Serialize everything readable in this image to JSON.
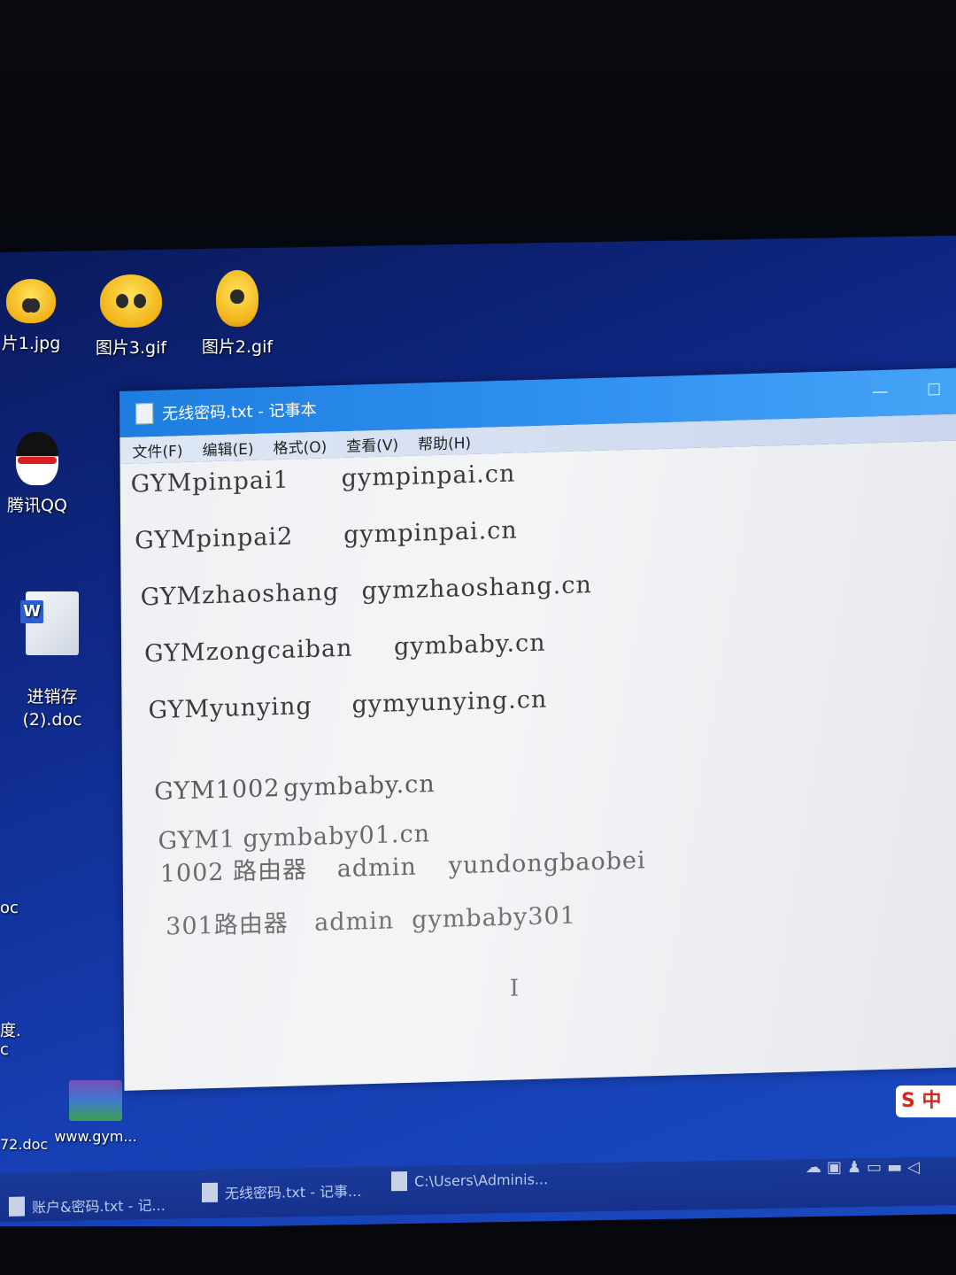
{
  "desktop": {
    "icons": [
      {
        "name": "picture-1",
        "label": "片1.jpg"
      },
      {
        "name": "picture-3",
        "label": "图片3.gif"
      },
      {
        "name": "picture-2",
        "label": "图片2.gif"
      },
      {
        "name": "tencent-qq",
        "label": "腾讯QQ"
      },
      {
        "name": "inventory-doc",
        "label": "进销存\n(2).doc"
      },
      {
        "name": "rar-archive",
        "label": "www.gym..."
      }
    ],
    "partial_labels": {
      "oc": "oc",
      "du": "度.",
      "c": "c",
      "doc2": "72.doc"
    }
  },
  "notepad": {
    "title": "无线密码.txt - 记事本",
    "menu": [
      "文件(F)",
      "编辑(E)",
      "格式(O)",
      "查看(V)",
      "帮助(H)"
    ],
    "lines": [
      {
        "a": "GYMpinpai1",
        "b": "gympinpai.cn"
      },
      {
        "a": "GYMpinpai2",
        "b": "gympinpai.cn"
      },
      {
        "a": "GYMzhaoshang",
        "b": "gymzhaoshang.cn"
      },
      {
        "a": "GYMzongcaiban",
        "b": "gymbaby.cn"
      },
      {
        "a": "GYMyunying",
        "b": "gymyunying.cn"
      },
      {
        "a": "GYM1002",
        "b": "gymbaby.cn"
      },
      {
        "a": "GYM1",
        "b": "gymbaby01.cn"
      },
      {
        "a": "1002 路由器",
        "b": "admin",
        "c": "yundongbaobei"
      },
      {
        "a": "301路由器",
        "b": "admin",
        "c": "gymbaby301"
      }
    ]
  },
  "taskbar": {
    "items": [
      "账户&密码.txt - 记...",
      "无线密码.txt - 记事...",
      "C:\\Users\\Adminis..."
    ]
  },
  "ime_label": "中"
}
